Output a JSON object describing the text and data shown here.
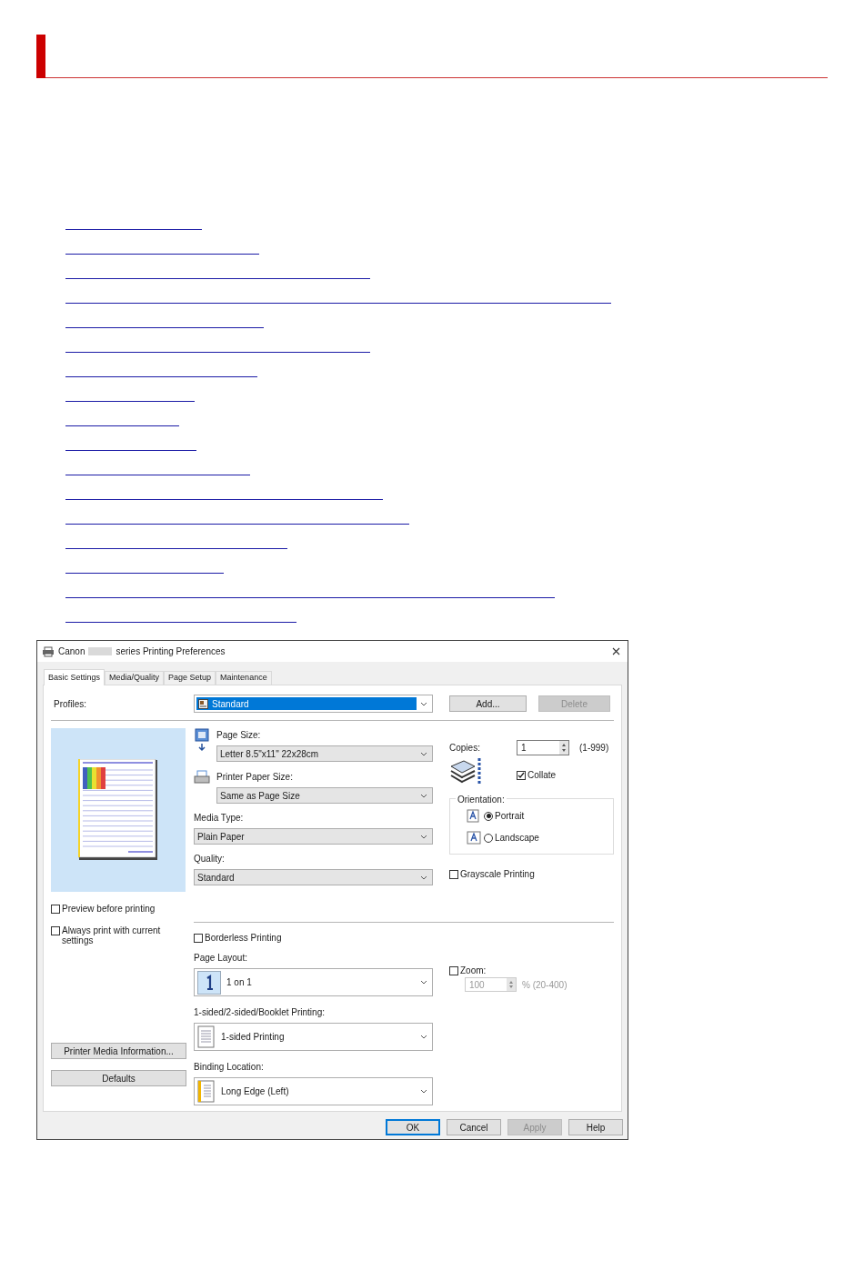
{
  "window": {
    "title_start": "Canon",
    "title_end": "series Printing Preferences"
  },
  "tabs": [
    {
      "label": "Basic Settings",
      "selected": true
    },
    {
      "label": "Media/Quality",
      "selected": false
    },
    {
      "label": "Page Setup",
      "selected": false
    },
    {
      "label": "Maintenance",
      "selected": false
    }
  ],
  "profiles": {
    "label": "Profiles:",
    "value": "Standard",
    "buttons": [
      {
        "label": "Add...",
        "disabled": false
      },
      {
        "label": "Delete",
        "disabled": true
      }
    ]
  },
  "page_size": {
    "label": "Page Size:",
    "value": "Letter 8.5\"x11\" 22x28cm"
  },
  "printer_paper_size": {
    "label": "Printer Paper Size:",
    "value": "Same as Page Size"
  },
  "media_type": {
    "label": "Media Type:",
    "value": "Plain Paper"
  },
  "quality": {
    "label": "Quality:",
    "value": "Standard"
  },
  "copies": {
    "label": "Copies:",
    "value": "1",
    "range": "(1-999)"
  },
  "collate": {
    "label": "Collate",
    "checked": true
  },
  "orientation": {
    "legend": "Orientation:",
    "options": [
      {
        "label": "Portrait",
        "selected": true
      },
      {
        "label": "Landscape",
        "selected": false
      }
    ]
  },
  "grayscale": {
    "label": "Grayscale Printing",
    "checked": false
  },
  "left_options": [
    {
      "label": "Preview before printing",
      "checked": false
    },
    {
      "label": "Always print with current settings",
      "checked": false
    }
  ],
  "left_buttons": [
    "Printer Media Information...",
    "Defaults"
  ],
  "borderless": {
    "label": "Borderless Printing",
    "checked": false
  },
  "page_layout": {
    "label": "Page Layout:",
    "value": "1 on 1"
  },
  "zoom": {
    "label": "Zoom:",
    "checked": false,
    "value": "100",
    "range": "% (20-400)",
    "disabled": true
  },
  "sided": {
    "label": "1-sided/2-sided/Booklet Printing:",
    "value": "1-sided Printing"
  },
  "binding": {
    "label": "Binding Location:",
    "value": "Long Edge (Left)"
  },
  "footer_buttons": [
    {
      "label": "OK",
      "disabled": false,
      "default": true
    },
    {
      "label": "Cancel",
      "disabled": false,
      "default": false
    },
    {
      "label": "Apply",
      "disabled": true,
      "default": false
    },
    {
      "label": "Help",
      "disabled": false,
      "default": false
    }
  ]
}
